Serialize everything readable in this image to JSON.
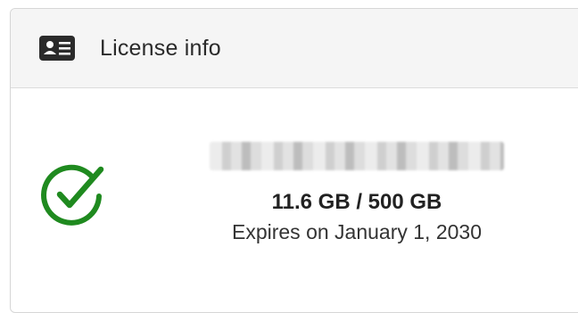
{
  "panel": {
    "title": "License info",
    "header_icon": "id-card-icon"
  },
  "license": {
    "status_icon": "check-circle-icon",
    "status_color": "#1f8a1f",
    "key_blurred": true,
    "usage": "11.6 GB / 500 GB",
    "expires": "Expires on January 1, 2030"
  },
  "colors": {
    "header_bg": "#f5f5f5",
    "border": "#d6d6d6",
    "success": "#1f8a1f"
  }
}
